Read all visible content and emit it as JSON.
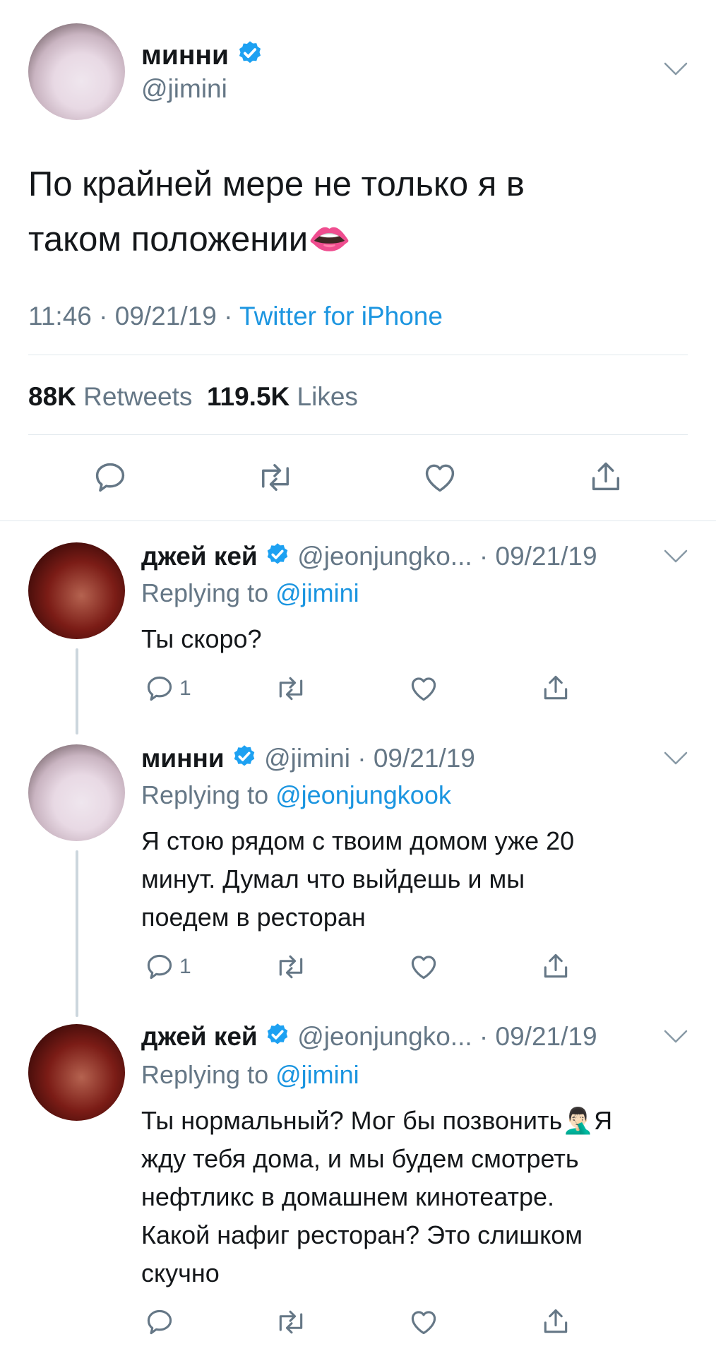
{
  "main_tweet": {
    "display_name": "минни",
    "handle": "@jimini",
    "text_line1": "По крайней мере не только я в",
    "text_line2": "таком положении",
    "emoji": "👄",
    "time": "11:46",
    "date": "09/21/19",
    "source": "Twitter for iPhone",
    "retweets_count": "88K",
    "retweets_label": "Retweets",
    "likes_count": "119.5K",
    "likes_label": "Likes"
  },
  "replies": [
    {
      "display_name": "джей кей",
      "handle": "@jeonjungko...",
      "date": "09/21/19",
      "replying_label": "Replying to",
      "replying_to": "@jimini",
      "lines": [
        "Ты скоро?"
      ],
      "reply_count": "1"
    },
    {
      "display_name": "минни",
      "handle": "@jimini",
      "date": "09/21/19",
      "replying_label": "Replying to",
      "replying_to": "@jeonjungkook",
      "lines": [
        "Я стою рядом с твоим домом уже 20",
        "минут. Думал что выйдешь и мы",
        "поедем в ресторан"
      ],
      "reply_count": "1"
    },
    {
      "display_name": "джей кей",
      "handle": "@jeonjungko...",
      "date": "09/21/19",
      "replying_label": "Replying to",
      "replying_to": "@jimini",
      "line1_pre": "Ты нормальный? Мог бы позвонить",
      "line1_emoji": "🤦🏻‍♂️",
      "line1_post": "Я",
      "lines": [
        "жду тебя дома, и мы будем смотреть",
        "нефтликс в домашнем кинотеатре.",
        "Какой нафиг ресторан? Это слишком",
        "скучно"
      ]
    }
  ],
  "separator": "·",
  "colors": {
    "blue": "#1b95e0",
    "gray": "#657786",
    "divider": "#e1e8ed",
    "verified": "#1da1f2"
  },
  "icons": [
    "verified-badge-icon",
    "chevron-down-icon",
    "reply-icon",
    "retweet-icon",
    "like-icon",
    "share-icon"
  ]
}
